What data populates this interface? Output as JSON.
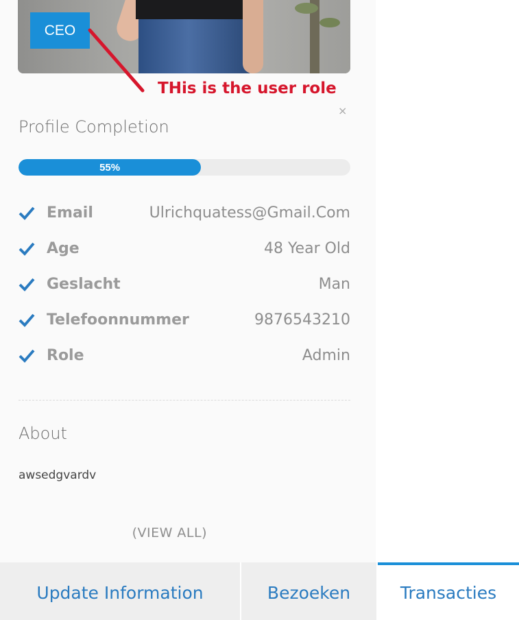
{
  "profile": {
    "role_badge": "CEO",
    "annotation": "THis is the user role",
    "close_symbol": "×",
    "completion_title": "Profile Completion",
    "completion_percent": 55,
    "completion_label": "55%",
    "fields": [
      {
        "label": "Email",
        "value": "Ulrichquatess@Gmail.Com"
      },
      {
        "label": "Age",
        "value": "48 Year Old"
      },
      {
        "label": "Geslacht",
        "value": "Man"
      },
      {
        "label": "Telefoonnummer",
        "value": "9876543210"
      },
      {
        "label": "Role",
        "value": "Admin"
      }
    ],
    "about_title": "About",
    "about_text": "awsedgvardv",
    "view_all": "(VIEW ALL)"
  },
  "tabs": [
    {
      "label": "Update Information",
      "active": false
    },
    {
      "label": "Bezoeken",
      "active": false
    },
    {
      "label": "Transacties",
      "active": true
    }
  ],
  "colors": {
    "accent": "#1a8fd8",
    "annotation": "#d6162c",
    "check": "#2a7bc0"
  },
  "icons": {
    "field_check": "check-icon",
    "close": "close-icon"
  }
}
